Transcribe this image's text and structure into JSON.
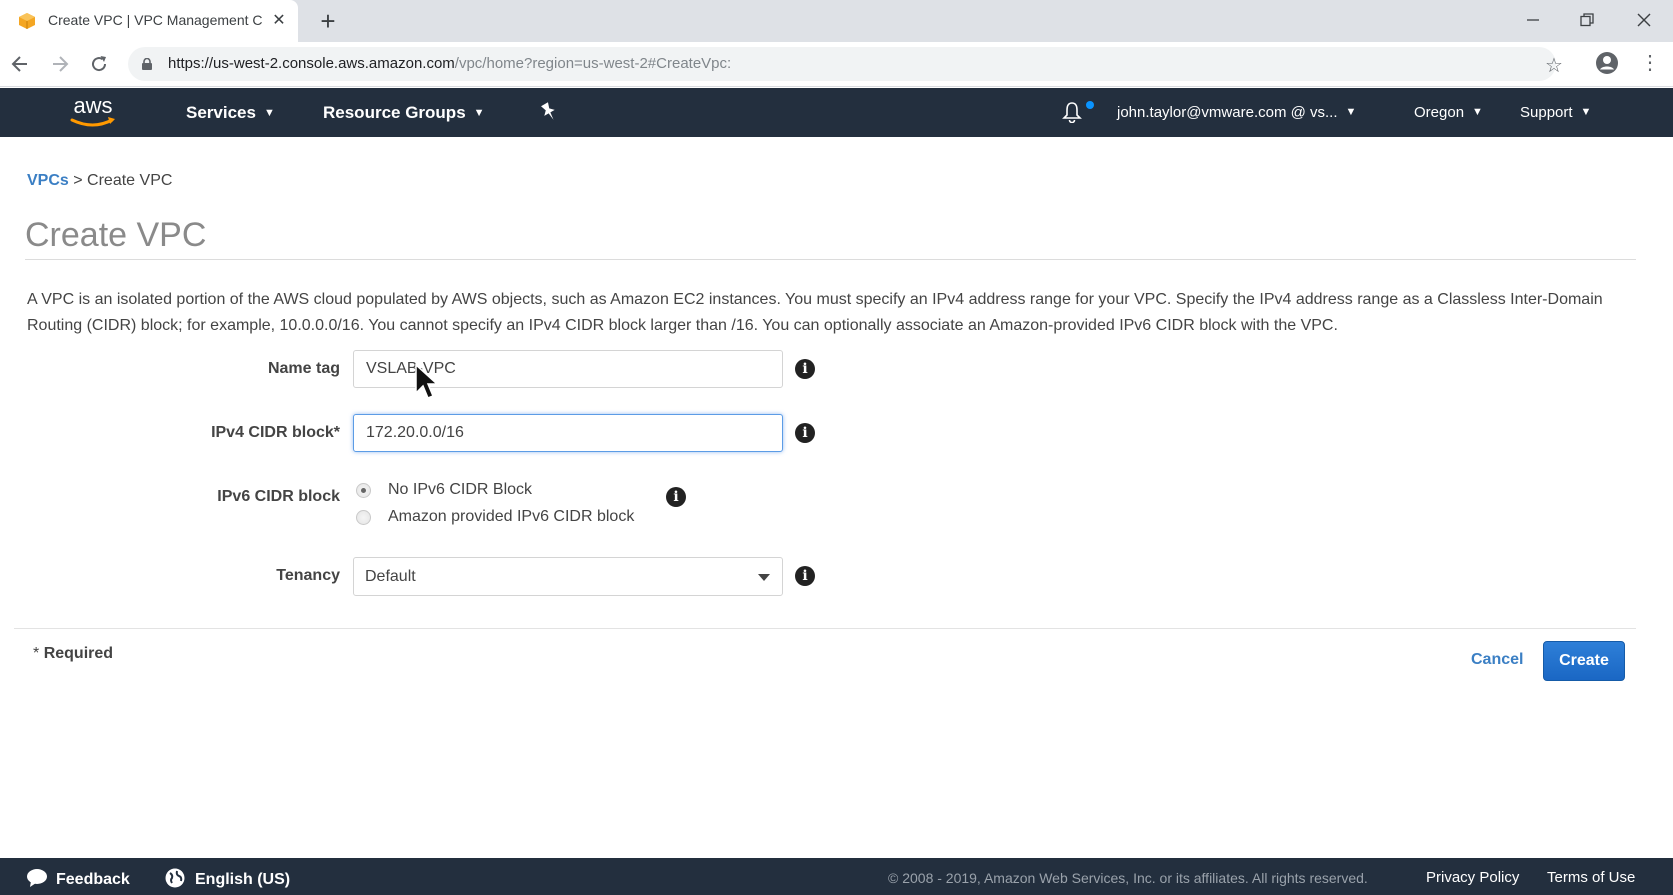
{
  "browser": {
    "tab_title": "Create VPC | VPC Management Console",
    "new_tab_label": "+",
    "url_host": "https://us-west-2.console.aws.amazon.com",
    "url_path": "/vpc/home?region=us-west-2#CreateVpc:",
    "icons": {
      "favicon": "aws-cube-icon",
      "close": "close-icon",
      "back": "arrow-left-icon",
      "forward": "arrow-right-icon",
      "reload": "reload-icon",
      "lock": "lock-icon",
      "bookmark": "star-icon",
      "account": "account-icon",
      "menu": "kebab-menu-icon"
    },
    "window_controls": {
      "minimize": "—",
      "restore": "❐",
      "close": "✕"
    }
  },
  "aws_nav": {
    "logo_text": "aws",
    "services_label": "Services",
    "resource_groups_label": "Resource Groups",
    "account_label": "john.taylor@vmware.com @ vs...",
    "region_label": "Oregon",
    "support_label": "Support",
    "notification_dot_color": "#0a94ff"
  },
  "breadcrumb": {
    "parent": "VPCs",
    "separator": ">",
    "current": "Create VPC"
  },
  "page": {
    "title": "Create VPC",
    "description": "A VPC is an isolated portion of the AWS cloud populated by AWS objects, such as Amazon EC2 instances. You must specify an IPv4 address range for your VPC. Specify the IPv4 address range as a Classless Inter-Domain Routing (CIDR) block; for example, 10.0.0.0/16. You cannot specify an IPv4 CIDR block larger than /16. You can optionally associate an Amazon-provided IPv6 CIDR block with the VPC."
  },
  "form": {
    "name_tag": {
      "label": "Name tag",
      "value": "VSLAB-VPC"
    },
    "ipv4_cidr": {
      "label": "IPv4 CIDR block*",
      "value": "172.20.0.0/16"
    },
    "ipv6_cidr": {
      "label": "IPv6 CIDR block",
      "options": [
        {
          "label": "No IPv6 CIDR Block",
          "checked": true
        },
        {
          "label": "Amazon provided IPv6 CIDR block",
          "checked": false
        }
      ]
    },
    "tenancy": {
      "label": "Tenancy",
      "value": "Default"
    },
    "info_glyph": "i",
    "required_note_asterisk": "*",
    "required_note": "Required",
    "cancel_label": "Cancel",
    "create_label": "Create"
  },
  "footer": {
    "feedback_label": "Feedback",
    "language_label": "English (US)",
    "copyright": "© 2008 - 2019, Amazon Web Services, Inc. or its affiliates. All rights reserved.",
    "privacy_label": "Privacy Policy",
    "terms_label": "Terms of Use"
  },
  "colors": {
    "nav_bg": "#232f3e",
    "link": "#3b7fc4",
    "primary_button": "#1f6fcf",
    "aws_orange": "#ff9900"
  }
}
